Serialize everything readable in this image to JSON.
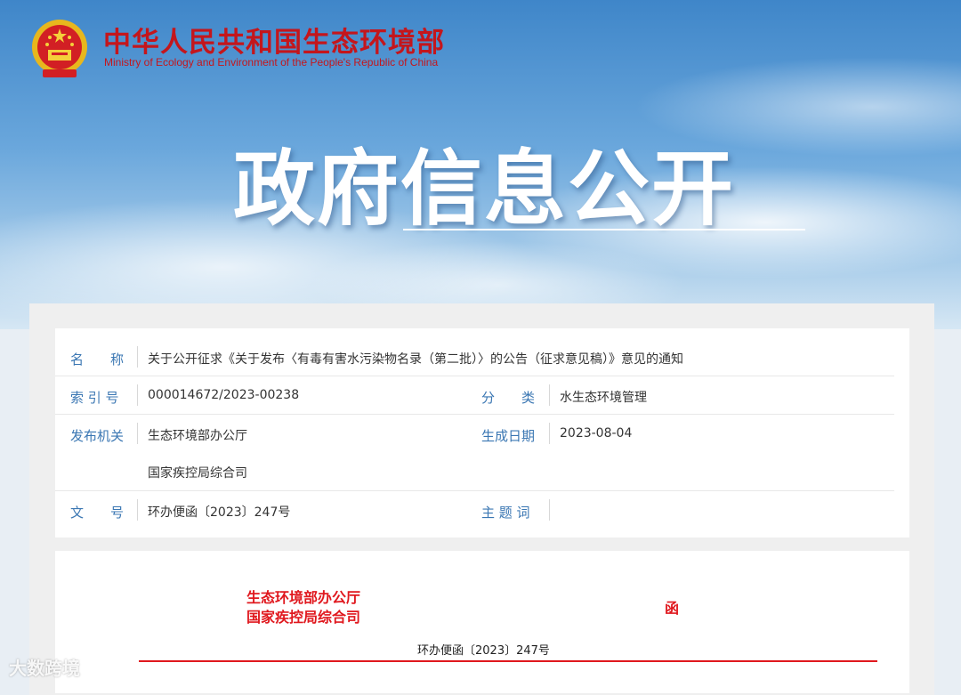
{
  "header": {
    "ministry_cn": "中华人民共和国生态环境部",
    "ministry_en": "Ministry of Ecology and Environment of the People's Republic of China",
    "page_title": "政府信息公开"
  },
  "info": {
    "name_label": "名　　称",
    "name_value": "关于公开征求《关于发布〈有毒有害水污染物名录（第二批）〉的公告（征求意见稿）》意见的通知",
    "index_label": "索 引 号",
    "index_value": "000014672/2023-00238",
    "category_label": "分　　类",
    "category_value": "水生态环境管理",
    "issuer_label": "发布机关",
    "issuer_value_1": "生态环境部办公厅",
    "issuer_value_2": "国家疾控局综合司",
    "date_label": "生成日期",
    "date_value": "2023-08-04",
    "docno_label": "文　　号",
    "docno_value": "环办便函〔2023〕247号",
    "subject_label": "主 题 词",
    "subject_value": ""
  },
  "document": {
    "org_1": "生态环境部办公厅",
    "org_2": "国家疾控局综合司",
    "han": "函",
    "doc_number": "环办便函〔2023〕247号"
  },
  "watermark": "大数跨境",
  "colors": {
    "brand_red": "#c4161c",
    "label_blue": "#3b77b3",
    "doc_red": "#e0181e"
  }
}
